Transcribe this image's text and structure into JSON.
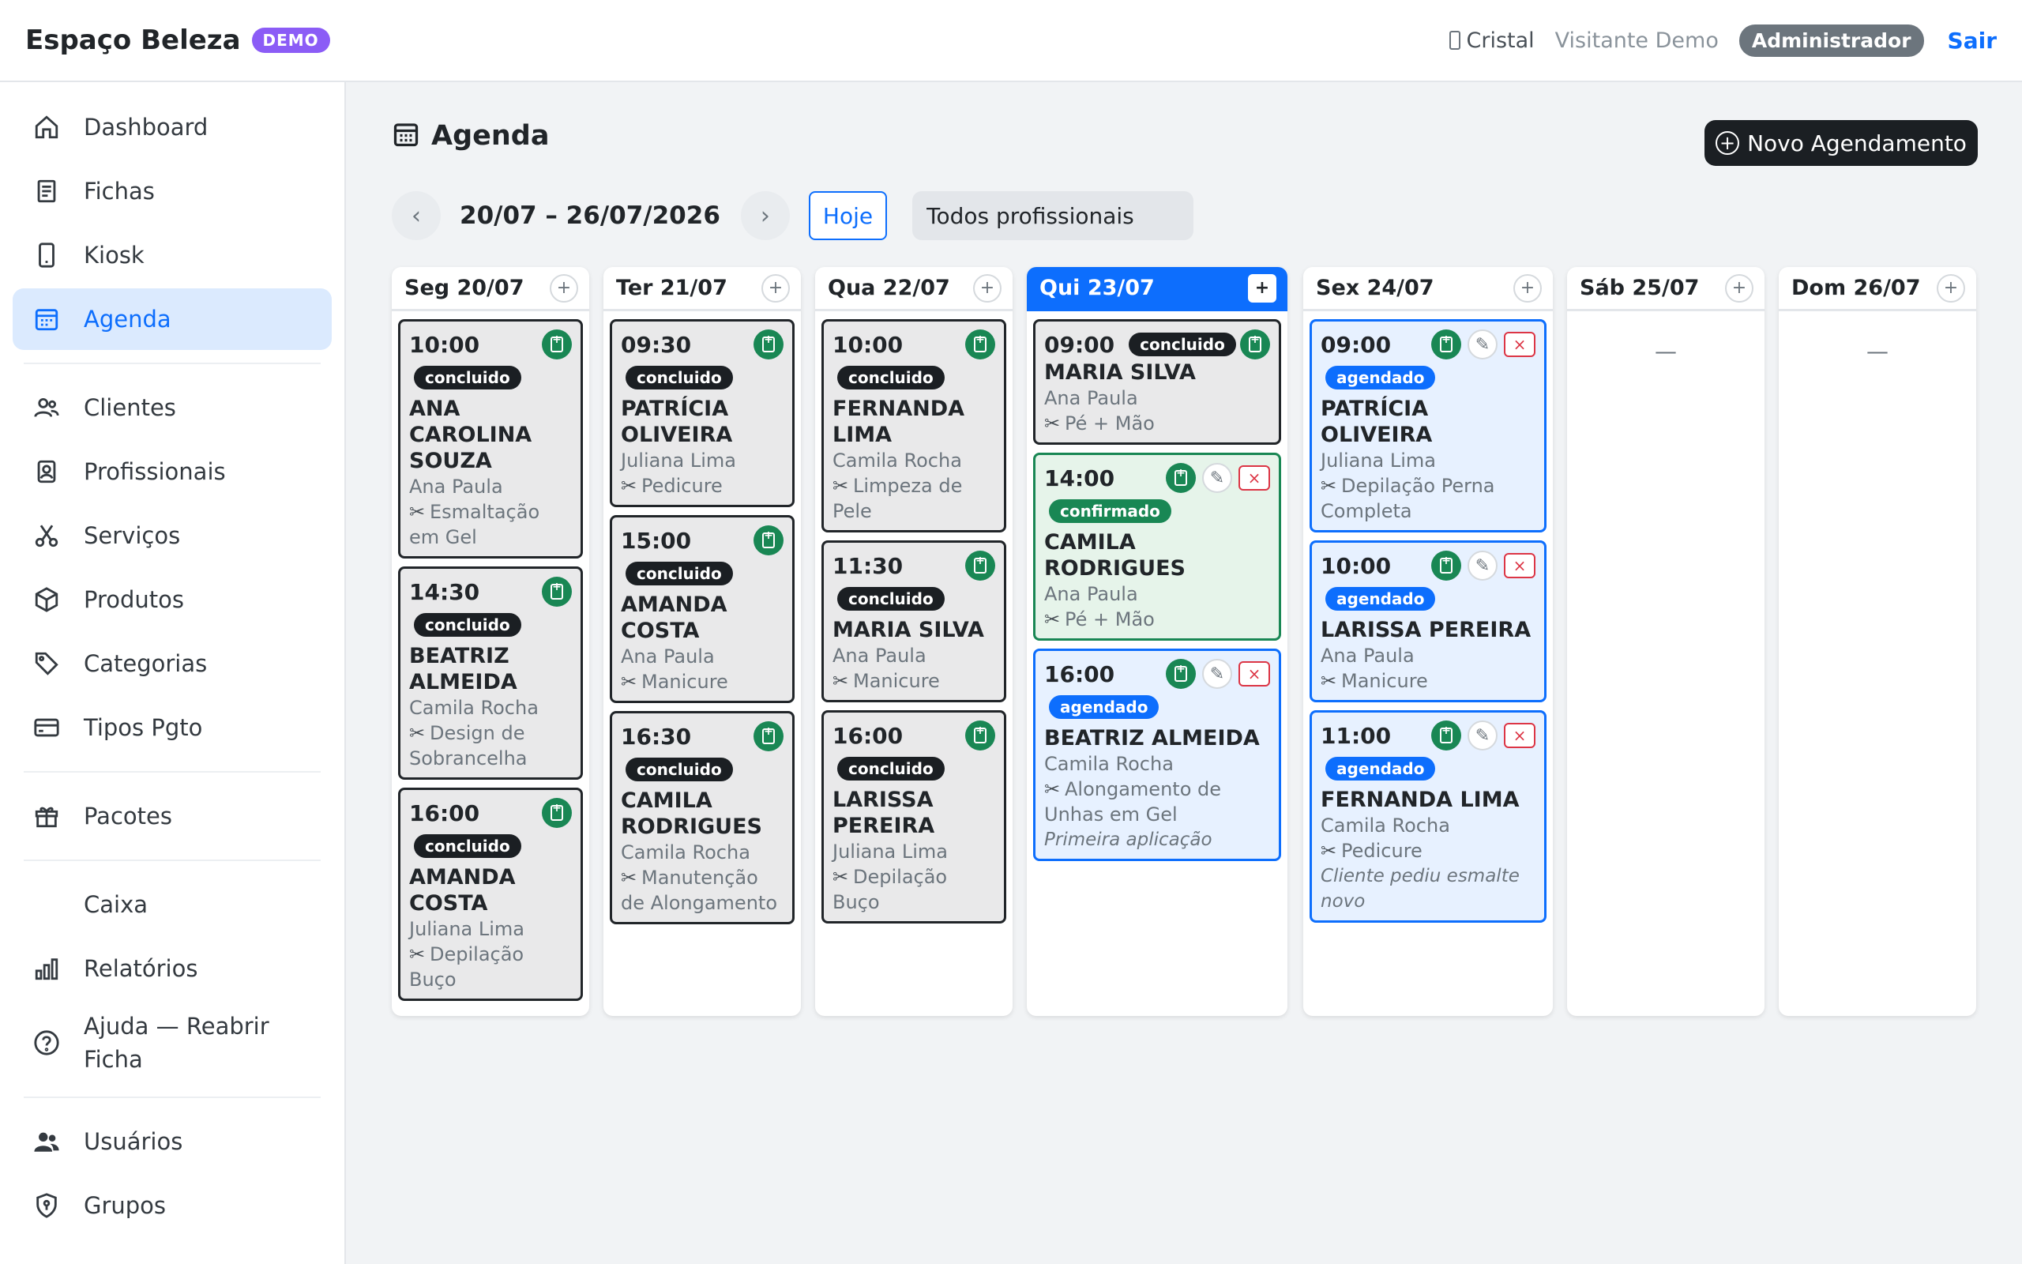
{
  "topbar": {
    "brand": "Espaço Beleza",
    "demo_badge": "DEMO",
    "user": "Cristal",
    "visitor": "Visitante Demo",
    "role": "Administrador",
    "logout": "Sair"
  },
  "sidebar": {
    "items": [
      {
        "label": "Dashboard",
        "icon": "house-icon"
      },
      {
        "label": "Fichas",
        "icon": "document-icon"
      },
      {
        "label": "Kiosk",
        "icon": "tablet-icon"
      },
      {
        "label": "Agenda",
        "icon": "calendar-icon",
        "active": true
      },
      {
        "label": "Clientes",
        "icon": "people-icon"
      },
      {
        "label": "Profissionais",
        "icon": "badge-icon"
      },
      {
        "label": "Serviços",
        "icon": "scissors-icon"
      },
      {
        "label": "Produtos",
        "icon": "box-icon"
      },
      {
        "label": "Categorias",
        "icon": "tags-icon"
      },
      {
        "label": "Tipos Pgto",
        "icon": "credit-card-icon"
      },
      {
        "label": "Pacotes",
        "icon": "gift-icon"
      },
      {
        "label": "Caixa",
        "icon": "cash-icon"
      },
      {
        "label": "Relatórios",
        "icon": "bar-chart-icon"
      },
      {
        "label": "Ajuda — Reabrir Ficha",
        "icon": "help-icon"
      },
      {
        "label": "Usuários",
        "icon": "users-icon"
      },
      {
        "label": "Grupos",
        "icon": "shield-icon"
      }
    ]
  },
  "page": {
    "title": "Agenda",
    "new_button": "Novo Agendamento",
    "week_range": "20/07 – 26/07/2026",
    "today_button": "Hoje",
    "professional_filter": "Todos profissionais",
    "prev_glyph": "‹",
    "next_glyph": "›",
    "add_glyph": "+",
    "empty_glyph": "—"
  },
  "days": [
    {
      "name": "Seg 20/07",
      "appointments": [
        {
          "time": "10:00",
          "status": "concluido",
          "client": "ANA CAROLINA SOUZA",
          "professional": "Ana Paula",
          "service": "Esmaltação em Gel"
        },
        {
          "time": "14:30",
          "status": "concluido",
          "client": "BEATRIZ ALMEIDA",
          "professional": "Camila Rocha",
          "service": "Design de Sobrancelha"
        },
        {
          "time": "16:00",
          "status": "concluido",
          "client": "AMANDA COSTA",
          "professional": "Juliana Lima",
          "service": "Depilação Buço"
        }
      ]
    },
    {
      "name": "Ter 21/07",
      "appointments": [
        {
          "time": "09:30",
          "status": "concluido",
          "client": "PATRÍCIA OLIVEIRA",
          "professional": "Juliana Lima",
          "service": "Pedicure"
        },
        {
          "time": "15:00",
          "status": "concluido",
          "client": "AMANDA COSTA",
          "professional": "Ana Paula",
          "service": "Manicure"
        },
        {
          "time": "16:30",
          "status": "concluido",
          "client": "CAMILA RODRIGUES",
          "professional": "Camila Rocha",
          "service": "Manutenção de Alongamento"
        }
      ]
    },
    {
      "name": "Qua 22/07",
      "appointments": [
        {
          "time": "10:00",
          "status": "concluido",
          "client": "FERNANDA LIMA",
          "professional": "Camila Rocha",
          "service": "Limpeza de Pele"
        },
        {
          "time": "11:30",
          "status": "concluido",
          "client": "MARIA SILVA",
          "professional": "Ana Paula",
          "service": "Manicure"
        },
        {
          "time": "16:00",
          "status": "concluido",
          "client": "LARISSA PEREIRA",
          "professional": "Juliana Lima",
          "service": "Depilação Buço"
        }
      ]
    },
    {
      "name": "Qui 23/07",
      "today": true,
      "appointments": [
        {
          "time": "09:00",
          "status": "concluido",
          "client": "MARIA SILVA",
          "professional": "Ana Paula",
          "service": "Pé + Mão"
        },
        {
          "time": "14:00",
          "status": "confirmado",
          "client": "CAMILA RODRIGUES",
          "professional": "Ana Paula",
          "service": "Pé + Mão"
        },
        {
          "time": "16:00",
          "status": "agendado",
          "client": "BEATRIZ ALMEIDA",
          "professional": "Camila Rocha",
          "service": "Alongamento de Unhas em Gel",
          "note": "Primeira aplicação"
        }
      ]
    },
    {
      "name": "Sex 24/07",
      "appointments": [
        {
          "time": "09:00",
          "status": "agendado",
          "client": "PATRÍCIA OLIVEIRA",
          "professional": "Juliana Lima",
          "service": "Depilação Perna Completa"
        },
        {
          "time": "10:00",
          "status": "agendado",
          "client": "LARISSA PEREIRA",
          "professional": "Ana Paula",
          "service": "Manicure"
        },
        {
          "time": "11:00",
          "status": "agendado",
          "client": "FERNANDA LIMA",
          "professional": "Camila Rocha",
          "service": "Pedicure",
          "note": "Cliente pediu esmalte novo"
        }
      ]
    },
    {
      "name": "Sáb 25/07",
      "appointments": []
    },
    {
      "name": "Dom 26/07",
      "appointments": []
    }
  ],
  "colors": {
    "primary": "#0d6efd",
    "success": "#198754",
    "danger": "#dc3545",
    "dark": "#1b1f23",
    "demo": "#8b5cf6"
  }
}
